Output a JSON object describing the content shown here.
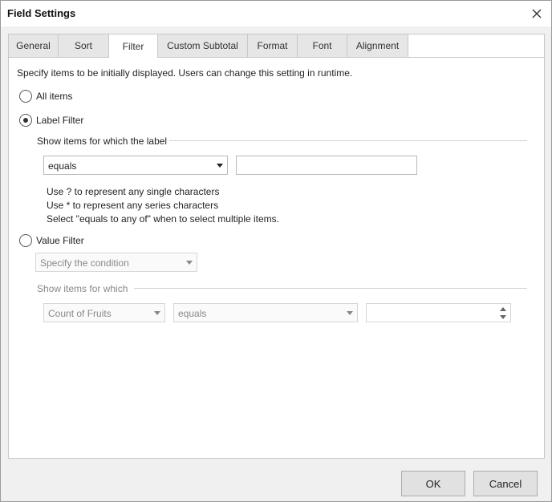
{
  "dialog": {
    "title": "Field Settings"
  },
  "tabs": [
    {
      "label": "General"
    },
    {
      "label": "Sort"
    },
    {
      "label": "Filter"
    },
    {
      "label": "Custom Subtotal"
    },
    {
      "label": "Format"
    },
    {
      "label": "Font"
    },
    {
      "label": "Alignment"
    }
  ],
  "active_tab": "Filter",
  "filter": {
    "description": "Specify items to be initially displayed. Users can change this setting in runtime.",
    "all_items": {
      "label": "All items",
      "checked": false
    },
    "label_filter": {
      "label": "Label Filter",
      "checked": true,
      "group_label": "Show items for which the label",
      "condition": "equals",
      "value": "",
      "hints": [
        "Use ? to represent any single characters",
        "Use * to represent any series characters",
        "Select \"equals to any of\" when to select multiple items."
      ]
    },
    "value_filter": {
      "label": "Value Filter",
      "checked": false,
      "condition_placeholder": "Specify the condition",
      "group_label": "Show items for which",
      "field": "Count of Fruits",
      "operator": "equals",
      "value": ""
    }
  },
  "buttons": {
    "ok": "OK",
    "cancel": "Cancel"
  }
}
